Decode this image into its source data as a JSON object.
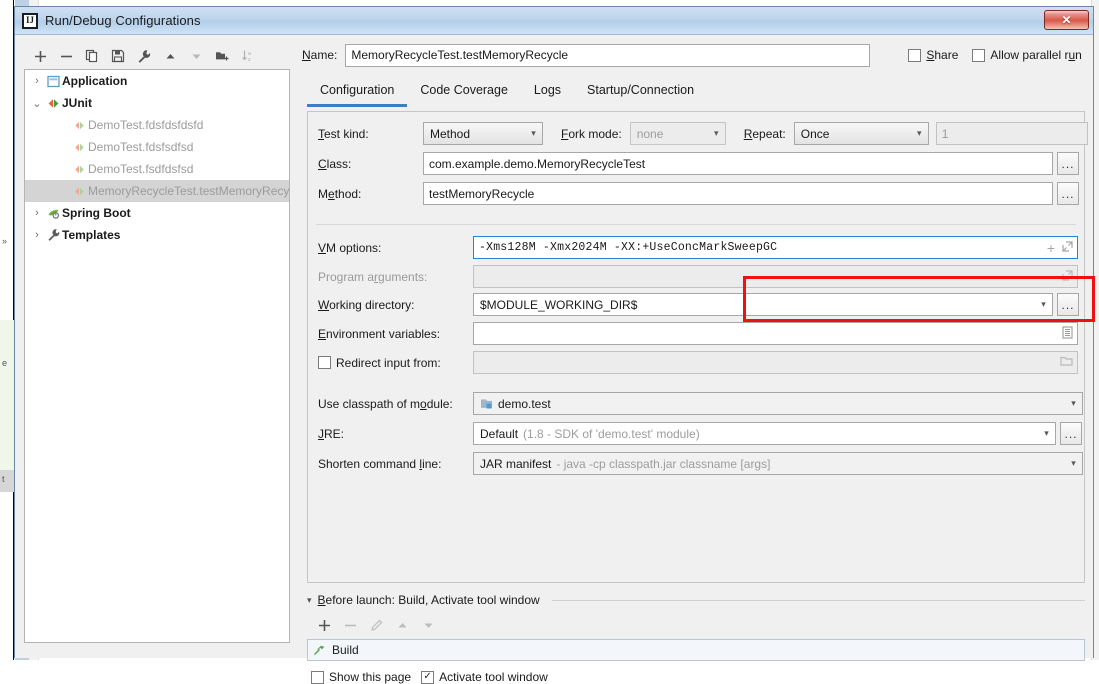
{
  "window": {
    "title": "Run/Debug Configurations",
    "app_icon": "intellij-idea-icon",
    "close_label": "✕"
  },
  "tree_toolbar": {
    "buttons": [
      {
        "name": "add-configuration-button",
        "icon": "plus-icon",
        "label": "+"
      },
      {
        "name": "remove-configuration-button",
        "icon": "minus-icon",
        "label": "−"
      },
      {
        "name": "copy-configuration-button",
        "icon": "copy-icon",
        "label": "copy"
      },
      {
        "name": "save-configuration-button",
        "icon": "save-icon",
        "label": "save"
      },
      {
        "name": "edit-templates-button",
        "icon": "wrench-icon",
        "label": "wrench"
      },
      {
        "name": "move-up-button",
        "icon": "arrow-up-icon",
        "label": "up"
      },
      {
        "name": "move-down-button",
        "icon": "arrow-down-icon",
        "label": "down"
      },
      {
        "name": "new-folder-button",
        "icon": "folder-add-icon",
        "label": "folder"
      },
      {
        "name": "sort-configurations-button",
        "icon": "sort-alpha-icon",
        "label": "sort"
      }
    ]
  },
  "tree": {
    "items": [
      {
        "label": "Application",
        "icon": "application-icon",
        "type": "group",
        "expanded": false,
        "twisty": "›"
      },
      {
        "label": "JUnit",
        "icon": "junit-icon",
        "type": "group",
        "expanded": true,
        "twisty": "⌄"
      },
      {
        "label": "DemoTest.fdsfdsfdsfd",
        "icon": "junit-run-icon",
        "type": "child",
        "selected": false
      },
      {
        "label": "DemoTest.fdsfsdfsd",
        "icon": "junit-run-icon",
        "type": "child",
        "selected": false
      },
      {
        "label": "DemoTest.fsdfdsfsd",
        "icon": "junit-run-icon",
        "type": "child",
        "selected": false
      },
      {
        "label": "MemoryRecycleTest.testMemoryRecycle",
        "icon": "junit-run-icon",
        "type": "child",
        "selected": true
      },
      {
        "label": "Spring Boot",
        "icon": "spring-boot-icon",
        "type": "group",
        "expanded": false,
        "twisty": "›"
      },
      {
        "label": "Templates",
        "icon": "templates-wrench-icon",
        "type": "group",
        "expanded": false,
        "twisty": "›"
      }
    ]
  },
  "header": {
    "name_label": "Name:",
    "name_value": "MemoryRecycleTest.testMemoryRecycle",
    "share_label": "Share",
    "share_checked": false,
    "allow_parallel_label": "Allow parallel run",
    "allow_parallel_checked": false
  },
  "tabs": [
    {
      "label": "Configuration",
      "active": true
    },
    {
      "label": "Code Coverage",
      "active": false
    },
    {
      "label": "Logs",
      "active": false
    },
    {
      "label": "Startup/Connection",
      "active": false
    }
  ],
  "form": {
    "test_kind_label": "Test kind:",
    "test_kind_value": "Method",
    "fork_mode_label": "Fork mode:",
    "fork_mode_value": "none",
    "fork_mode_disabled": true,
    "repeat_label": "Repeat:",
    "repeat_value": "Once",
    "repeat_count_value": "1",
    "repeat_count_disabled": true,
    "class_label": "Class:",
    "class_value": "com.example.demo.MemoryRecycleTest",
    "class_browse": "...",
    "method_label": "Method:",
    "method_value": "testMemoryRecycle",
    "method_browse": "...",
    "vm_options_label": "VM options:",
    "vm_options_value": "-Xms128M -Xmx2024M -XX:+UseConcMarkSweepGC",
    "vm_options_add_icon": "plus-icon",
    "vm_options_expand_icon": "expand-icon",
    "program_arguments_label": "Program arguments:",
    "program_arguments_value": "",
    "program_arguments_expand_icon": "expand-icon",
    "working_directory_label": "Working directory:",
    "working_directory_value": "$MODULE_WORKING_DIR$",
    "working_directory_browse": "...",
    "environment_variables_label": "Environment variables:",
    "environment_variables_value": "",
    "environment_variables_icon": "list-edit-icon",
    "redirect_input_label": "Redirect input from:",
    "redirect_input_checked": false,
    "redirect_input_value": "",
    "redirect_input_icon": "folder-icon",
    "classpath_module_label": "Use classpath of module:",
    "classpath_module_value": "demo.test",
    "classpath_module_icon": "module-icon",
    "jre_label": "JRE:",
    "jre_value": "Default",
    "jre_hint": "(1.8 - SDK of 'demo.test' module)",
    "jre_browse": "...",
    "shorten_cmd_label": "Shorten command line:",
    "shorten_cmd_value": "JAR manifest",
    "shorten_cmd_hint": "- java -cp classpath.jar classname [args]"
  },
  "before_launch": {
    "twisty": "▾",
    "title": "Before launch: Build, Activate tool window",
    "toolbar": [
      {
        "name": "add-task-button",
        "icon": "plus-icon",
        "label": "+",
        "enabled": true
      },
      {
        "name": "remove-task-button",
        "icon": "minus-icon",
        "label": "−",
        "enabled": false
      },
      {
        "name": "edit-task-button",
        "icon": "pencil-icon",
        "label": "edit",
        "enabled": false
      },
      {
        "name": "move-task-up-button",
        "icon": "arrow-up-icon",
        "label": "up",
        "enabled": false
      },
      {
        "name": "move-task-down-button",
        "icon": "arrow-down-icon",
        "label": "down",
        "enabled": false
      }
    ],
    "task_icon": "hammer-icon",
    "task_label": "Build",
    "show_page_label": "Show this page",
    "show_page_checked": false,
    "activate_tool_window_label": "Activate tool window",
    "activate_tool_window_checked": true,
    "check_mark": "✓"
  },
  "colors": {
    "accent_blue": "#3d7dc4",
    "focus_blue": "#2f7fd0",
    "highlight_red": "#f01010",
    "selection_grey": "#d4d4d4",
    "junit_icon": "#e8643c",
    "spring_green": "#6cb33e",
    "hammer_green": "#59a14f"
  }
}
